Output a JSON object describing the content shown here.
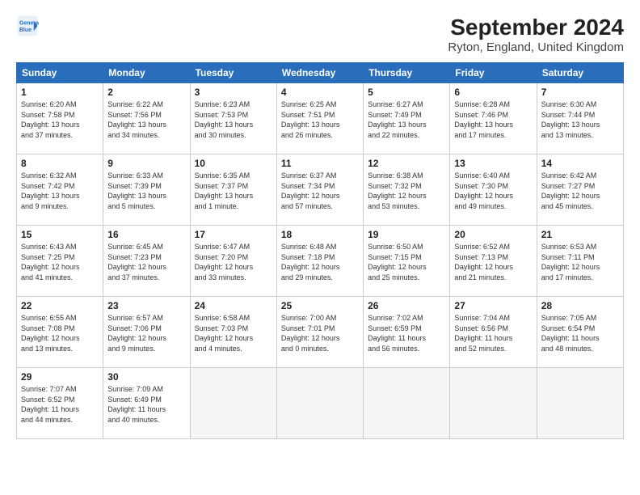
{
  "header": {
    "logo_line1": "General",
    "logo_line2": "Blue",
    "title": "September 2024",
    "subtitle": "Ryton, England, United Kingdom"
  },
  "columns": [
    "Sunday",
    "Monday",
    "Tuesday",
    "Wednesday",
    "Thursday",
    "Friday",
    "Saturday"
  ],
  "weeks": [
    [
      {
        "day": "1",
        "detail": "Sunrise: 6:20 AM\nSunset: 7:58 PM\nDaylight: 13 hours\nand 37 minutes."
      },
      {
        "day": "2",
        "detail": "Sunrise: 6:22 AM\nSunset: 7:56 PM\nDaylight: 13 hours\nand 34 minutes."
      },
      {
        "day": "3",
        "detail": "Sunrise: 6:23 AM\nSunset: 7:53 PM\nDaylight: 13 hours\nand 30 minutes."
      },
      {
        "day": "4",
        "detail": "Sunrise: 6:25 AM\nSunset: 7:51 PM\nDaylight: 13 hours\nand 26 minutes."
      },
      {
        "day": "5",
        "detail": "Sunrise: 6:27 AM\nSunset: 7:49 PM\nDaylight: 13 hours\nand 22 minutes."
      },
      {
        "day": "6",
        "detail": "Sunrise: 6:28 AM\nSunset: 7:46 PM\nDaylight: 13 hours\nand 17 minutes."
      },
      {
        "day": "7",
        "detail": "Sunrise: 6:30 AM\nSunset: 7:44 PM\nDaylight: 13 hours\nand 13 minutes."
      }
    ],
    [
      {
        "day": "8",
        "detail": "Sunrise: 6:32 AM\nSunset: 7:42 PM\nDaylight: 13 hours\nand 9 minutes."
      },
      {
        "day": "9",
        "detail": "Sunrise: 6:33 AM\nSunset: 7:39 PM\nDaylight: 13 hours\nand 5 minutes."
      },
      {
        "day": "10",
        "detail": "Sunrise: 6:35 AM\nSunset: 7:37 PM\nDaylight: 13 hours\nand 1 minute."
      },
      {
        "day": "11",
        "detail": "Sunrise: 6:37 AM\nSunset: 7:34 PM\nDaylight: 12 hours\nand 57 minutes."
      },
      {
        "day": "12",
        "detail": "Sunrise: 6:38 AM\nSunset: 7:32 PM\nDaylight: 12 hours\nand 53 minutes."
      },
      {
        "day": "13",
        "detail": "Sunrise: 6:40 AM\nSunset: 7:30 PM\nDaylight: 12 hours\nand 49 minutes."
      },
      {
        "day": "14",
        "detail": "Sunrise: 6:42 AM\nSunset: 7:27 PM\nDaylight: 12 hours\nand 45 minutes."
      }
    ],
    [
      {
        "day": "15",
        "detail": "Sunrise: 6:43 AM\nSunset: 7:25 PM\nDaylight: 12 hours\nand 41 minutes."
      },
      {
        "day": "16",
        "detail": "Sunrise: 6:45 AM\nSunset: 7:23 PM\nDaylight: 12 hours\nand 37 minutes."
      },
      {
        "day": "17",
        "detail": "Sunrise: 6:47 AM\nSunset: 7:20 PM\nDaylight: 12 hours\nand 33 minutes."
      },
      {
        "day": "18",
        "detail": "Sunrise: 6:48 AM\nSunset: 7:18 PM\nDaylight: 12 hours\nand 29 minutes."
      },
      {
        "day": "19",
        "detail": "Sunrise: 6:50 AM\nSunset: 7:15 PM\nDaylight: 12 hours\nand 25 minutes."
      },
      {
        "day": "20",
        "detail": "Sunrise: 6:52 AM\nSunset: 7:13 PM\nDaylight: 12 hours\nand 21 minutes."
      },
      {
        "day": "21",
        "detail": "Sunrise: 6:53 AM\nSunset: 7:11 PM\nDaylight: 12 hours\nand 17 minutes."
      }
    ],
    [
      {
        "day": "22",
        "detail": "Sunrise: 6:55 AM\nSunset: 7:08 PM\nDaylight: 12 hours\nand 13 minutes."
      },
      {
        "day": "23",
        "detail": "Sunrise: 6:57 AM\nSunset: 7:06 PM\nDaylight: 12 hours\nand 9 minutes."
      },
      {
        "day": "24",
        "detail": "Sunrise: 6:58 AM\nSunset: 7:03 PM\nDaylight: 12 hours\nand 4 minutes."
      },
      {
        "day": "25",
        "detail": "Sunrise: 7:00 AM\nSunset: 7:01 PM\nDaylight: 12 hours\nand 0 minutes."
      },
      {
        "day": "26",
        "detail": "Sunrise: 7:02 AM\nSunset: 6:59 PM\nDaylight: 11 hours\nand 56 minutes."
      },
      {
        "day": "27",
        "detail": "Sunrise: 7:04 AM\nSunset: 6:56 PM\nDaylight: 11 hours\nand 52 minutes."
      },
      {
        "day": "28",
        "detail": "Sunrise: 7:05 AM\nSunset: 6:54 PM\nDaylight: 11 hours\nand 48 minutes."
      }
    ],
    [
      {
        "day": "29",
        "detail": "Sunrise: 7:07 AM\nSunset: 6:52 PM\nDaylight: 11 hours\nand 44 minutes."
      },
      {
        "day": "30",
        "detail": "Sunrise: 7:09 AM\nSunset: 6:49 PM\nDaylight: 11 hours\nand 40 minutes."
      },
      {
        "day": "",
        "detail": ""
      },
      {
        "day": "",
        "detail": ""
      },
      {
        "day": "",
        "detail": ""
      },
      {
        "day": "",
        "detail": ""
      },
      {
        "day": "",
        "detail": ""
      }
    ]
  ]
}
